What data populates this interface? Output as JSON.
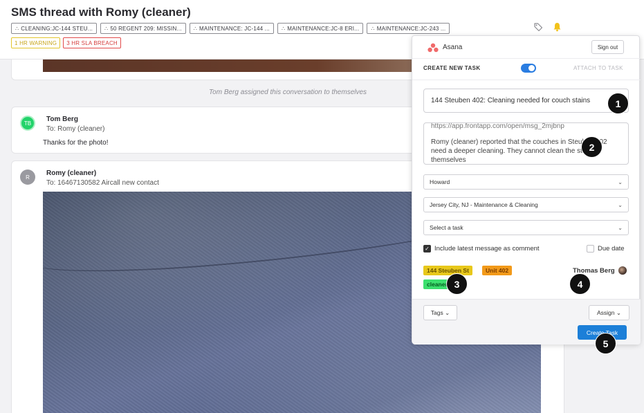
{
  "header": {
    "title": "SMS thread with Romy (cleaner)",
    "chips": [
      "CLEANING:JC-144 STEU...",
      "50 REGENT 209: MISSIN...",
      "MAINTENANCE: JC-144 ...",
      "MAINTENANCE:JC-8 ERI...",
      "MAINTENANCE:JC-243 ..."
    ],
    "flags": {
      "warning": "1 HR WARNING",
      "breach": "3 HR SLA BREACH"
    },
    "colors": {
      "warning": "#e3c52c",
      "breach": "#e24a4a"
    },
    "icons": {
      "tag": "tag-icon",
      "bell": "bell-icon",
      "chip": "team-icon"
    }
  },
  "conversation": {
    "system_note": "Tom Berg assigned this conversation to themselves",
    "messages": [
      {
        "avatar": "TB",
        "sender": "Tom Berg",
        "to": "To: Romy (cleaner)",
        "text": "Thanks for the photo!"
      },
      {
        "avatar": "R",
        "sender": "Romy (cleaner)",
        "to": "To: 16467130582 Aircall new contact"
      }
    ]
  },
  "asana": {
    "app_name": "Asana",
    "sign_out": "Sign out",
    "create_new_task": "CREATE NEW TASK",
    "attach_to_task": "ATTACH TO TASK",
    "task_title": "144 Steuben 402: Cleaning needed for couch stains",
    "description_link": "https://app.frontapp.com/open/msg_2mjbnp",
    "description_text": "Romy (cleaner) reported that the couches in Steuben 402 need a deeper cleaning. They cannot clean the stains themselves",
    "selects": {
      "assignee": "Howard",
      "project": "Jersey City, NJ - Maintenance & Cleaning",
      "task": "Select a task"
    },
    "include_comment_label": "Include latest message as comment",
    "include_comment_checked": true,
    "due_date_label": "Due date",
    "due_date_checked": false,
    "tags": [
      "144 Steuben St",
      "Unit 402",
      "cleaner"
    ],
    "tag_colors": [
      "#e8c81b",
      "#f29a1a",
      "#3ce06e"
    ],
    "assignee_name": "Thomas Berg",
    "tags_button": "Tags",
    "assign_button": "Assign",
    "create_button": "Create Task",
    "accent": "#1c7fd8"
  },
  "callouts": [
    "1",
    "2",
    "3",
    "4",
    "5"
  ]
}
